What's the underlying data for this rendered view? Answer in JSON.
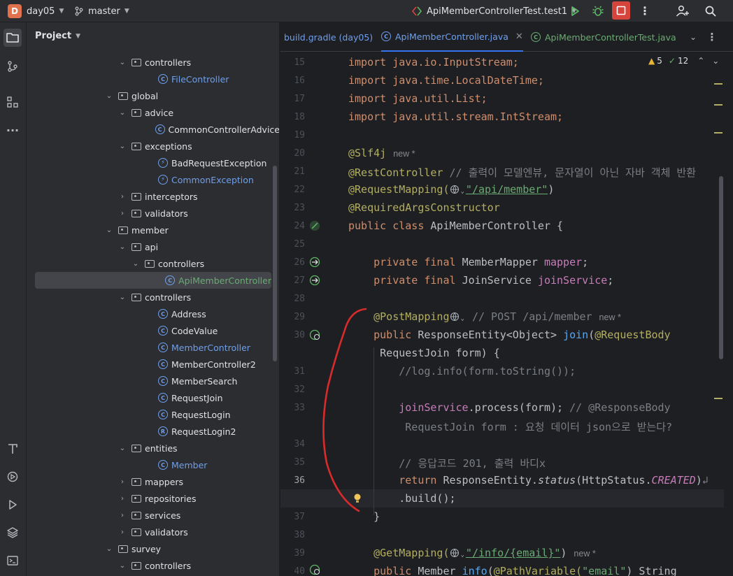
{
  "toolbar": {
    "project_badge": "D",
    "project_name": "day05",
    "branch": "master",
    "run_config": "ApiMemberControllerTest.test1"
  },
  "panel": {
    "title": "Project"
  },
  "tree": [
    {
      "label": "controllers",
      "kind": "folder",
      "depth": 7,
      "open": true
    },
    {
      "label": "FileController",
      "kind": "class",
      "depth": 9,
      "color": "blue"
    },
    {
      "label": "global",
      "kind": "folder",
      "depth": 6,
      "open": true
    },
    {
      "label": "advice",
      "kind": "folder",
      "depth": 7,
      "open": true
    },
    {
      "label": "CommonControllerAdvice",
      "kind": "class",
      "depth": 9
    },
    {
      "label": "exceptions",
      "kind": "folder",
      "depth": 7,
      "open": true
    },
    {
      "label": "BadRequestException",
      "kind": "exception",
      "depth": 9
    },
    {
      "label": "CommonException",
      "kind": "exception",
      "depth": 9,
      "color": "blue"
    },
    {
      "label": "interceptors",
      "kind": "folder",
      "depth": 7,
      "open": false
    },
    {
      "label": "validators",
      "kind": "folder",
      "depth": 7,
      "open": false
    },
    {
      "label": "member",
      "kind": "folder",
      "depth": 6,
      "open": true
    },
    {
      "label": "api",
      "kind": "folder",
      "depth": 7,
      "open": true
    },
    {
      "label": "controllers",
      "kind": "folder",
      "depth": 8,
      "open": true
    },
    {
      "label": "ApiMemberController",
      "kind": "class",
      "depth": 10,
      "color": "green",
      "selected": true
    },
    {
      "label": "controllers",
      "kind": "folder",
      "depth": 7,
      "open": true
    },
    {
      "label": "Address",
      "kind": "class",
      "depth": 9
    },
    {
      "label": "CodeValue",
      "kind": "class",
      "depth": 9
    },
    {
      "label": "MemberController",
      "kind": "class",
      "depth": 9,
      "color": "blue"
    },
    {
      "label": "MemberController2",
      "kind": "class",
      "depth": 9
    },
    {
      "label": "MemberSearch",
      "kind": "class",
      "depth": 9
    },
    {
      "label": "RequestJoin",
      "kind": "class",
      "depth": 9
    },
    {
      "label": "RequestLogin",
      "kind": "class",
      "depth": 9
    },
    {
      "label": "RequestLogin2",
      "kind": "record",
      "depth": 9
    },
    {
      "label": "entities",
      "kind": "folder",
      "depth": 7,
      "open": true
    },
    {
      "label": "Member",
      "kind": "class",
      "depth": 9,
      "color": "blue"
    },
    {
      "label": "mappers",
      "kind": "folder",
      "depth": 7,
      "open": false
    },
    {
      "label": "repositories",
      "kind": "folder",
      "depth": 7,
      "open": false
    },
    {
      "label": "services",
      "kind": "folder",
      "depth": 7,
      "open": false
    },
    {
      "label": "validators",
      "kind": "folder",
      "depth": 7,
      "open": false
    },
    {
      "label": "survey",
      "kind": "folder",
      "depth": 6,
      "open": true
    },
    {
      "label": "controllers",
      "kind": "folder",
      "depth": 7,
      "open": true
    }
  ],
  "tabs": [
    {
      "label": "build.gradle (day05)"
    },
    {
      "label": "ApiMemberController.java",
      "active": true
    },
    {
      "label": "ApiMemberControllerTest.java"
    }
  ],
  "inspections": {
    "warnings": "5",
    "typos": "12"
  },
  "editor": {
    "line_numbers": [
      "15",
      "16",
      "17",
      "18",
      "19",
      "20",
      "21",
      "22",
      "23",
      "24",
      "25",
      "26",
      "27",
      "28",
      "29",
      "30",
      "31",
      "32",
      "33",
      "34",
      "35",
      "36",
      "37",
      "38",
      "39",
      "40"
    ],
    "current_line": "36",
    "hint_new": "new *",
    "l15": "import java.io.InputStream;",
    "l16": "import java.time.LocalDateTime;",
    "l17": "import java.util.List;",
    "l18": "import java.util.stream.IntStream;",
    "l20": "@Slf4j",
    "l21a": "@RestController",
    "l21b": " // 출력이 모델엔뷰, 문자열이 아닌 자바 객체 반환",
    "l22a": "@RequestMapping(",
    "l22b": "\"/api/member\"",
    "l22c": ")",
    "l23": "@RequiredArgsConstructor",
    "l24a": "public class ",
    "l24b": "ApiMemberController {",
    "l26a": "    private final ",
    "l26b": "MemberMapper ",
    "l26c": "mapper",
    "l26d": ";",
    "l27a": "    private final ",
    "l27b": "JoinService ",
    "l27c": "joinService",
    "l27d": ";",
    "l29a": "    @PostMapping",
    "l29b": " // POST /api/member",
    "l30a": "    public ",
    "l30b": "ResponseEntity<Object> ",
    "l30c": "join",
    "l30d": "(",
    "l30e": "@RequestBody",
    "l30f": "     RequestJoin form) {",
    "l31": "        //log.info(form.toString());",
    "l33a": "        joinService",
    "l33b": ".process(form); ",
    "l33c": "// @ResponseBody",
    "l33d": "         RequestJoin form : 요청 데이터 json으로 받는다?",
    "l35": "        // 응답코드 201, 출력 바디x",
    "l36a": "        return ",
    "l36b": "ResponseEntity.",
    "l36c": "status",
    "l36d": "(HttpStatus.",
    "l36e": "CREATED",
    "l36f": ")",
    "l36g": "        .build();",
    "l37": "    }",
    "l39a": "    @GetMapping(",
    "l39b": "\"/info/{email}\"",
    "l39c": ")",
    "l40a": "    public ",
    "l40b": "Member ",
    "l40c": "info",
    "l40d": "(",
    "l40e": "@PathVariable(",
    "l40f": "\"email\"",
    "l40g": ") String"
  },
  "colors": {
    "annotation_stroke": "#d92b2b",
    "accent": "#3574f0"
  }
}
